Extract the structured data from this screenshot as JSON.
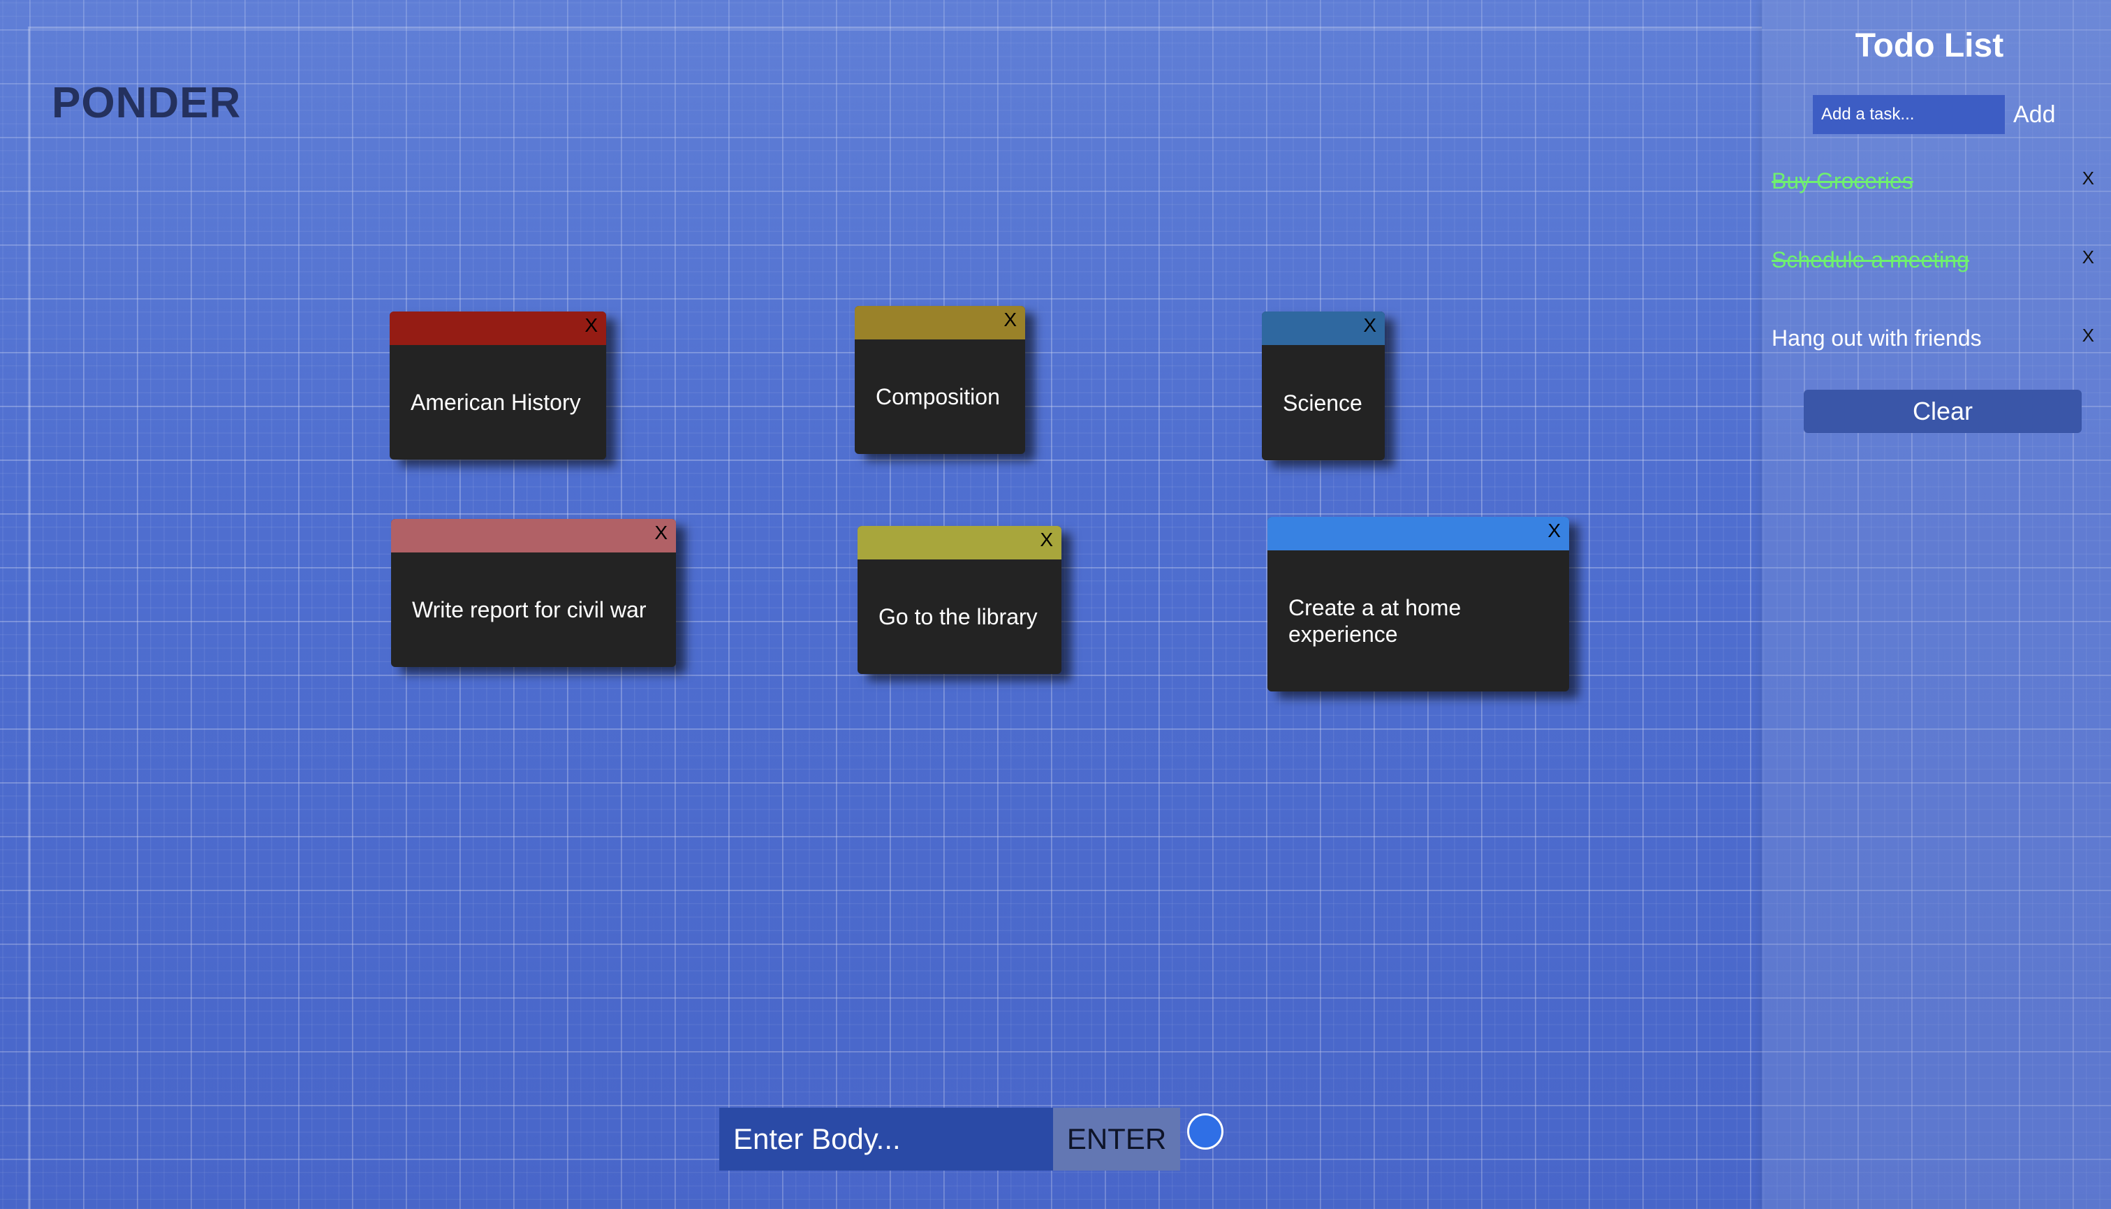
{
  "app": {
    "logo": "PONDER"
  },
  "notes": [
    {
      "title": "American History",
      "close": "X",
      "header_color": "#951c14"
    },
    {
      "title": "Composition",
      "close": "X",
      "header_color": "#9a8229"
    },
    {
      "title": "Science",
      "close": "X",
      "header_color": "#2f68a0"
    },
    {
      "title": "Write report for civil war",
      "close": "X",
      "header_color": "#b16166"
    },
    {
      "title": "Go to the library",
      "close": "X",
      "header_color": "#a8a63c"
    },
    {
      "title": "Create a at home experience",
      "close": "X",
      "header_color": "#3882e2"
    }
  ],
  "composer": {
    "placeholder": "Enter Body...",
    "enter_label": "ENTER",
    "selected_color": "#2f6fe6"
  },
  "sidebar": {
    "title": "Todo List",
    "input_placeholder": "Add a task...",
    "add_label": "Add",
    "items": [
      {
        "text": "Buy Groceries",
        "done": true,
        "remove": "X"
      },
      {
        "text": "Schedule a meeting",
        "done": true,
        "remove": "X"
      },
      {
        "text": "Hang out with friends",
        "done": false,
        "remove": "X"
      }
    ],
    "clear_label": "Clear"
  }
}
